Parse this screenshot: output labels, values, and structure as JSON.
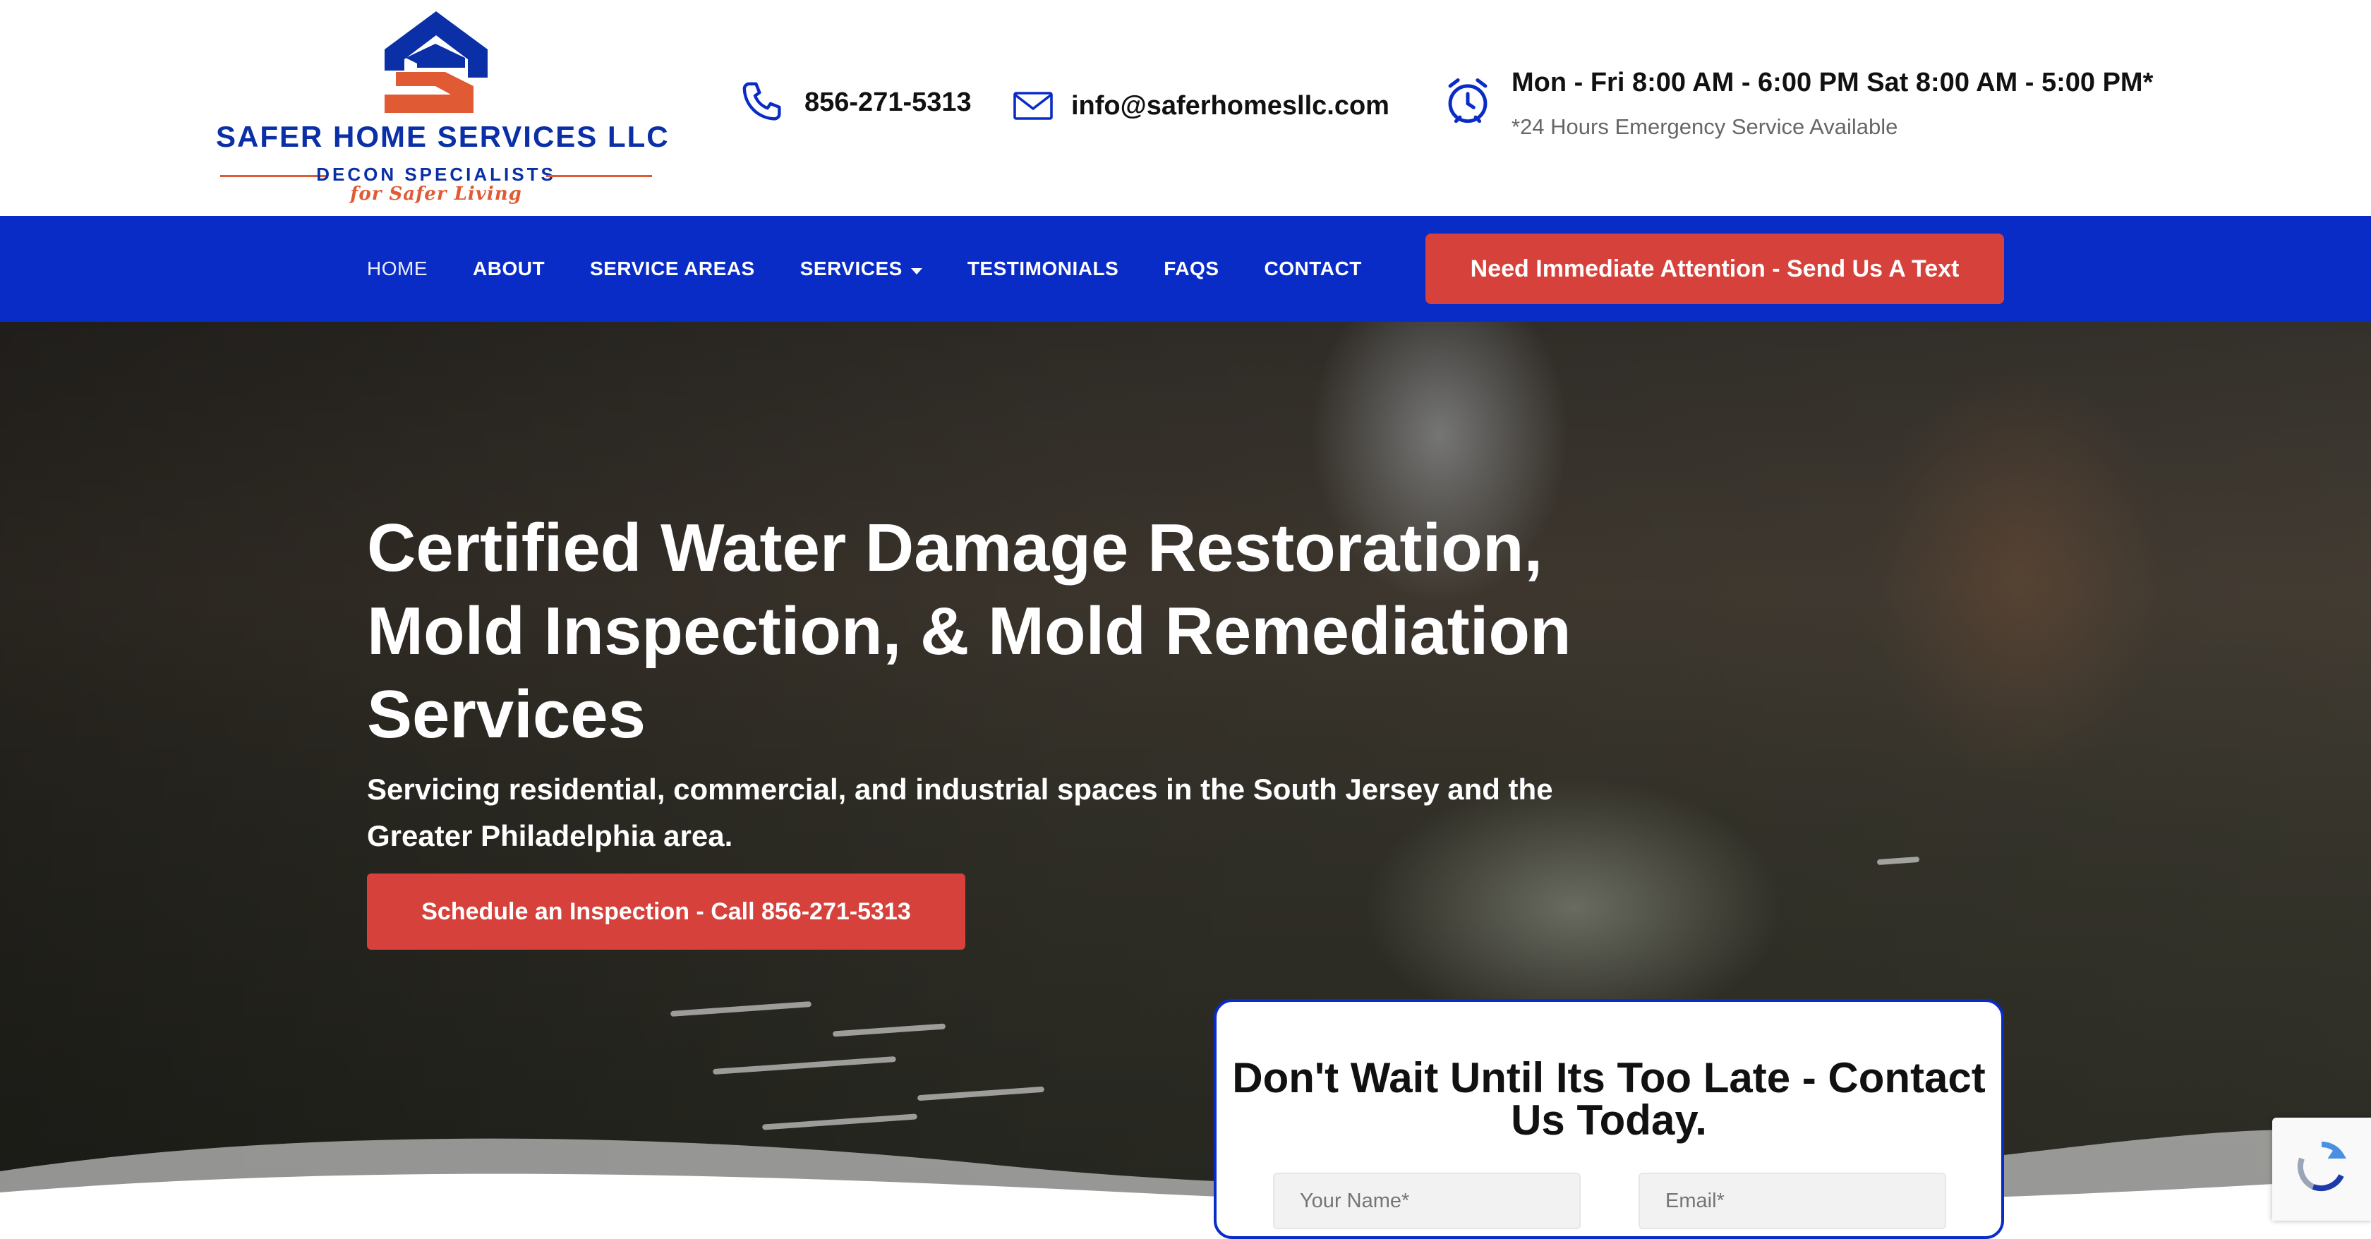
{
  "logo": {
    "title": "SAFER HOME SERVICES LLC",
    "subtitle": "DECON SPECIALISTS",
    "tagline": "for Safer Living",
    "colors": {
      "blue": "#0a2fa6",
      "orange": "#e05a33"
    }
  },
  "header": {
    "phone": {
      "icon": "phone-icon",
      "text": "856-271-5313"
    },
    "email": {
      "icon": "envelope-icon",
      "text": "info@saferhomesllc.com"
    },
    "hours": {
      "icon": "alarm-clock-icon",
      "text": "Mon - Fri 8:00 AM - 6:00 PM Sat 8:00 AM - 5:00 PM*",
      "note": "*24 Hours Emergency Service Available"
    }
  },
  "nav": {
    "items": [
      {
        "label": "HOME",
        "active": true
      },
      {
        "label": "ABOUT"
      },
      {
        "label": "SERVICE AREAS"
      },
      {
        "label": "SERVICES",
        "has_dropdown": true
      },
      {
        "label": "TESTIMONIALS"
      },
      {
        "label": "FAQS"
      },
      {
        "label": "CONTACT"
      }
    ],
    "cta_label": "Need Immediate Attention - Send Us A Text",
    "background": "#0a2cc6"
  },
  "hero": {
    "title": "Certified Water Damage Restoration, Mold Inspection, & Mold Remediation Services",
    "subtitle": "Servicing residential, commercial, and industrial spaces in the South Jersey and the Greater Philadelphia area.",
    "cta_label": "Schedule an Inspection - Call 856-271-5313",
    "cta_color": "#d6413b"
  },
  "contact_form": {
    "title": "Don't Wait Until Its Too Late - Contact Us Today.",
    "name_placeholder": "Your Name*",
    "email_placeholder": "Email*"
  }
}
